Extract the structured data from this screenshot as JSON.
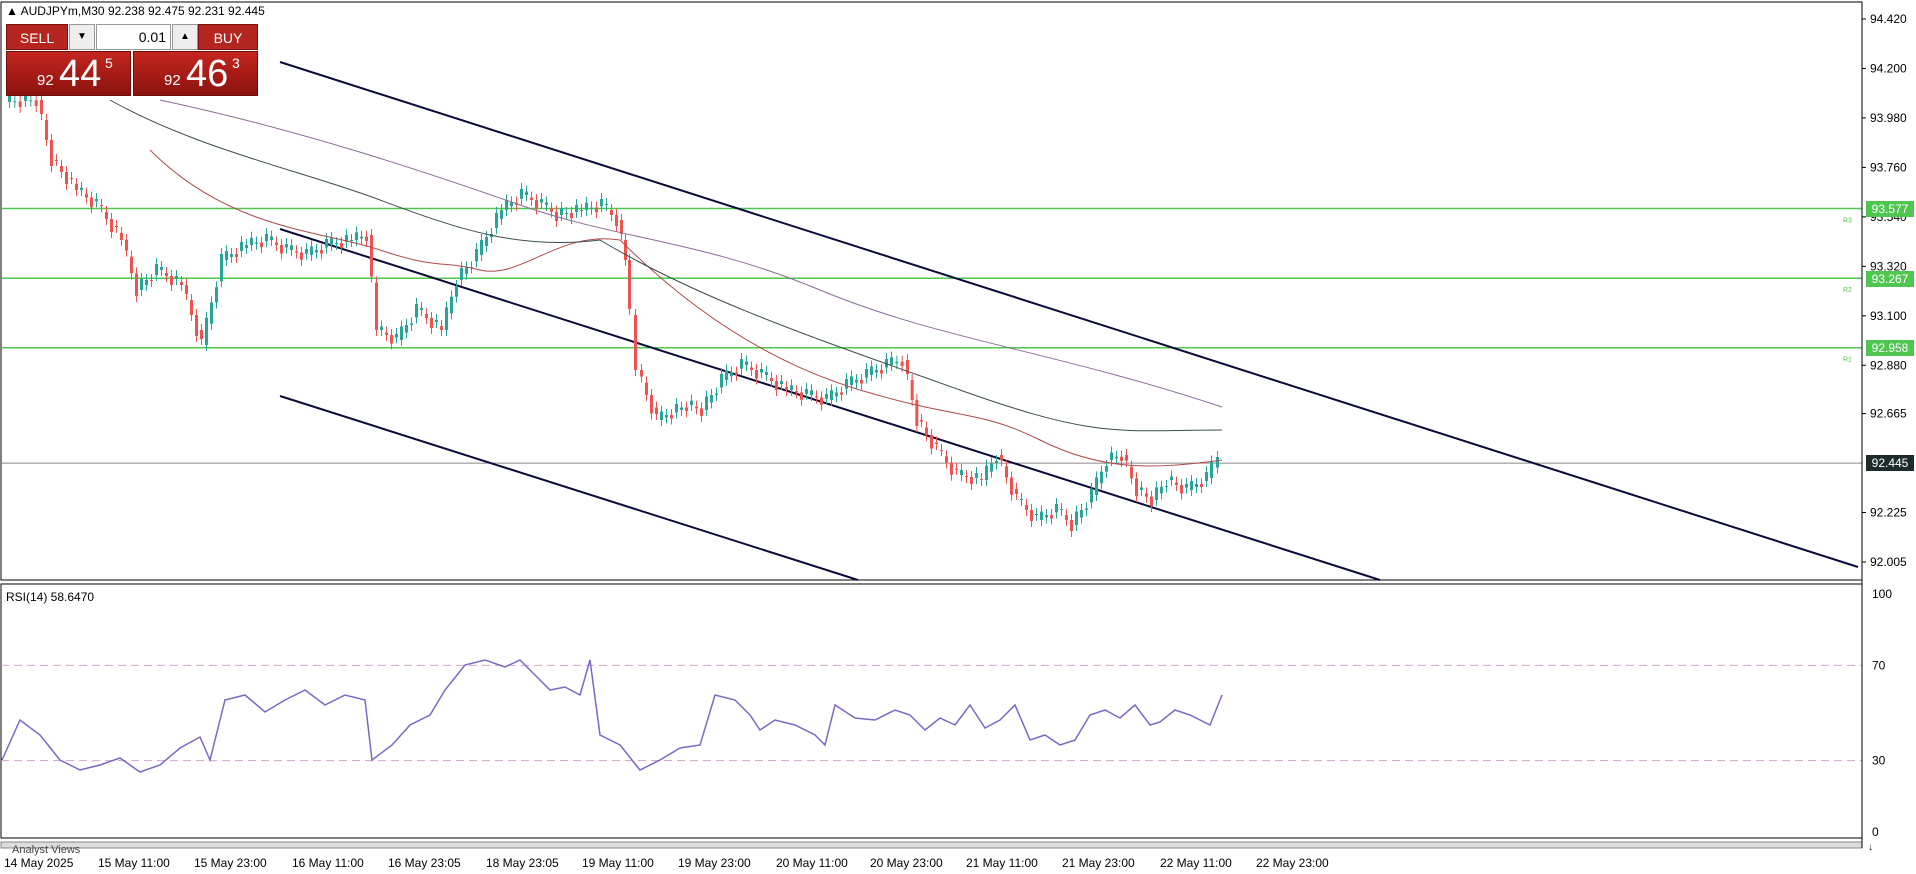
{
  "header": {
    "symbol": "AUDJPYm,M30",
    "ohlc": "92.238 92.475 92.231 92.445"
  },
  "one_click": {
    "sell_label": "SELL",
    "buy_label": "BUY",
    "lot": "0.01",
    "sell_price": {
      "prefix": "92",
      "big": "44",
      "sup": "5"
    },
    "buy_price": {
      "prefix": "92",
      "big": "46",
      "sup": "3"
    }
  },
  "price_axis": {
    "labels": [
      "94.420",
      "94.200",
      "93.980",
      "93.760",
      "93.540",
      "93.320",
      "93.100",
      "92.880",
      "92.665",
      "92.225",
      "92.005"
    ]
  },
  "levels": [
    {
      "value": "93.577",
      "tag": "R3"
    },
    {
      "value": "93.267",
      "tag": "R2"
    },
    {
      "value": "92.958",
      "tag": "R1"
    }
  ],
  "current_price": "92.445",
  "rsi": {
    "title": "RSI(14) 58.6470",
    "labels": [
      "100",
      "70",
      "30",
      "0"
    ]
  },
  "time_axis": {
    "labels": [
      "14 May 2025",
      "15 May 11:00",
      "15 May 23:00",
      "16 May 11:00",
      "16 May 23:05",
      "18 May 23:05",
      "19 May 11:00",
      "19 May 23:00",
      "20 May 11:00",
      "20 May 23:00",
      "21 May 11:00",
      "21 May 23:00",
      "22 May 11:00",
      "22 May 23:00"
    ]
  },
  "footer": {
    "analyst": "Analyst Views"
  },
  "colors": {
    "bull": "#26a69a",
    "bear": "#ef5350",
    "level_line": "#4fc64f",
    "channel": "#0b0b3b",
    "rsi_line": "#7b68c4",
    "sell_button": "#b5251f",
    "price_box": "#1d2b2b"
  }
}
